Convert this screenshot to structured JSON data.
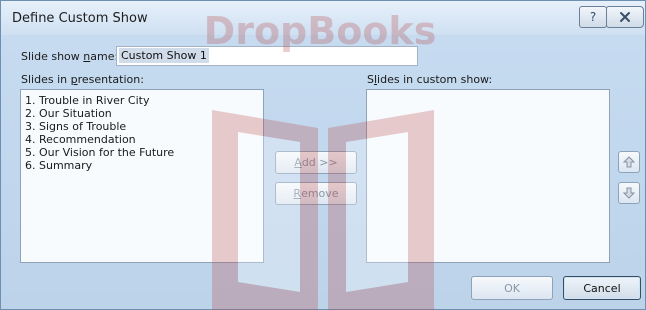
{
  "dialog": {
    "title": "Define Custom Show",
    "help_glyph": "?",
    "name_label_prefix": "Slide show ",
    "name_label_underlined": "n",
    "name_label_suffix": "ame:",
    "name_value": "Custom Show 1",
    "slides_label_prefix": "Slides in ",
    "slides_label_underlined": "p",
    "slides_label_suffix": "resentation:",
    "custom_label_prefix": "S",
    "custom_label_underlined": "l",
    "custom_label_suffix": "ides in custom show:",
    "slides": [
      "1. Trouble in River City",
      "2. Our Situation",
      "3. Signs of Trouble",
      "4. Recommendation",
      "5. Our Vision for the Future",
      "6. Summary"
    ],
    "custom_slides": [],
    "add_underlined": "A",
    "add_rest": "dd >>",
    "remove_underlined": "R",
    "remove_rest": "emove",
    "ok_label": "OK",
    "cancel_label": "Cancel"
  },
  "watermark": {
    "text": "DropBooks",
    "color": "#b64a4a"
  },
  "icons": {
    "close": "close-x-icon",
    "move_up": "arrow-up-icon",
    "move_down": "arrow-down-icon"
  }
}
